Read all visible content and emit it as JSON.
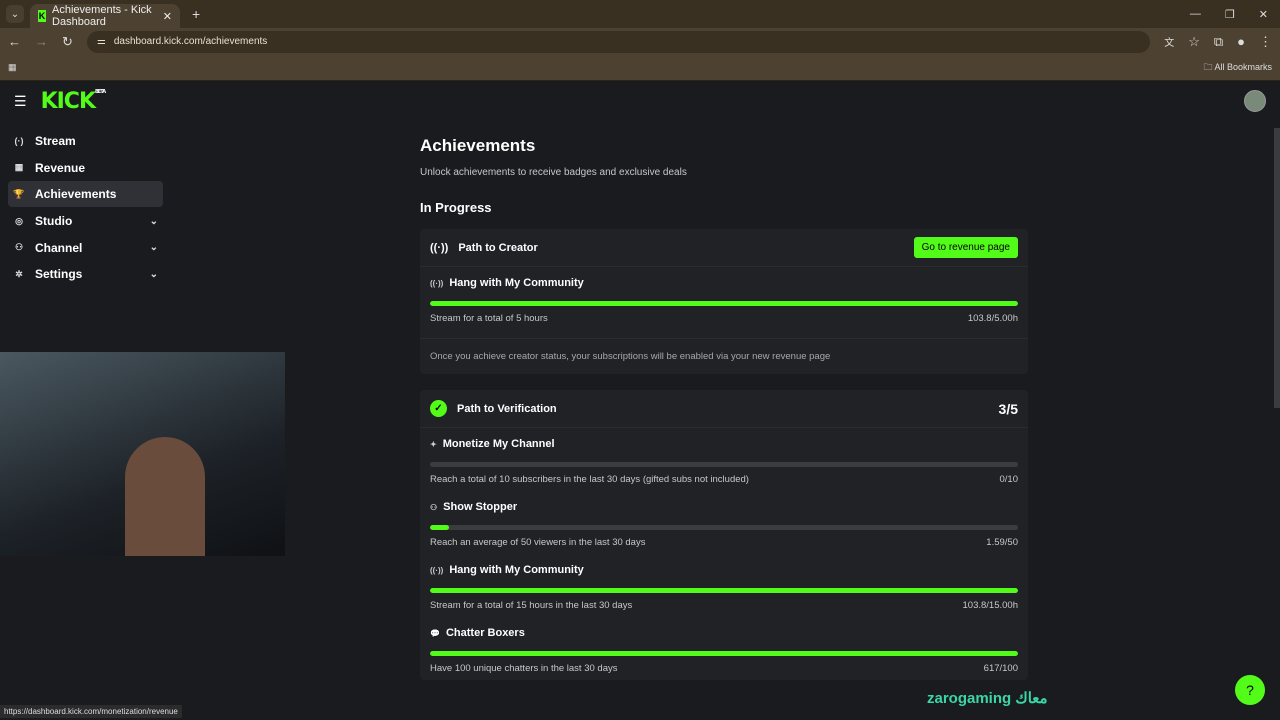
{
  "browser": {
    "tab_title": "Achievements - Kick Dashboard",
    "url": "dashboard.kick.com/achievements",
    "bookmarks": "All Bookmarks",
    "status_url": "https://dashboard.kick.com/monetization/revenue"
  },
  "header": {
    "logo": "KICK",
    "beta": "BETA"
  },
  "sidebar": {
    "items": [
      {
        "label": "Stream",
        "icon": "(·)"
      },
      {
        "label": "Revenue",
        "icon": "▦"
      },
      {
        "label": "Achievements",
        "icon": "🏆"
      },
      {
        "label": "Studio",
        "icon": "◎"
      },
      {
        "label": "Channel",
        "icon": "⚇"
      },
      {
        "label": "Settings",
        "icon": "✲"
      }
    ]
  },
  "main": {
    "title": "Achievements",
    "subtitle": "Unlock achievements to receive badges and exclusive deals",
    "section": "In Progress",
    "creator": {
      "title": "Path to Creator",
      "button": "Go to revenue page",
      "items": [
        {
          "title": "Hang with My Community",
          "desc": "Stream for a total of 5 hours",
          "value": "103.8/5.00h",
          "progress": 1
        }
      ],
      "note": "Once you achieve creator status, your subscriptions will be enabled via your new revenue page"
    },
    "verification": {
      "title": "Path to Verification",
      "count": "3/5",
      "items": [
        {
          "title": "Monetize My Channel",
          "desc": "Reach a total of 10 subscribers in the last 30 days (gifted subs not included)",
          "value": "0/10",
          "progress": 0
        },
        {
          "title": "Show Stopper",
          "desc": "Reach an average of 50 viewers in the last 30 days",
          "value": "1.59/50",
          "progress": 0.032
        },
        {
          "title": "Hang with My Community",
          "desc": "Stream for a total of 15 hours in the last 30 days",
          "value": "103.8/15.00h",
          "progress": 1
        },
        {
          "title": "Chatter Boxers",
          "desc": "Have 100 unique chatters in the last 30 days",
          "value": "617/100",
          "progress": 1
        }
      ]
    }
  },
  "watermark": "zarogaming معاك"
}
